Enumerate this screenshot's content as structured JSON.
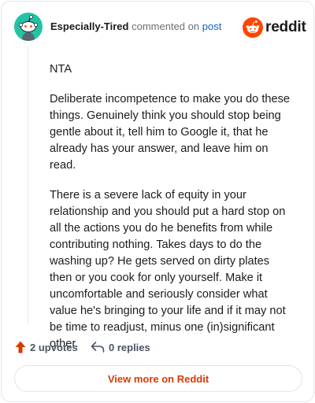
{
  "header": {
    "username": "Especially-Tired",
    "action_text": "commented on",
    "post_link": "post",
    "brand": "reddit"
  },
  "comment": {
    "paragraphs": [
      "NTA",
      "Deliberate incompetence to make you do these things. Genuinely think you should stop being gentle about it, tell him to Google it, that he already has your answer, and leave him on read.",
      "There is a severe lack of equity in your relationship and you should put a hard stop on all the actions you do he benefits from while contributing nothing. Takes days to do the washing up? He gets served on dirty plates then or you cook for only yourself. Make it uncomfortable and seriously consider what value he's bringing to your life and if it may not be time to readjust, minus one (in)significant other."
    ]
  },
  "actions": {
    "upvotes": "2 upvotes",
    "replies": "0 replies"
  },
  "cta": {
    "label": "View more on Reddit"
  },
  "icons": {
    "avatar": "snoo-avatar-icon",
    "brand": "reddit-logo-icon",
    "upvote": "upvote-arrow-icon",
    "reply": "reply-arrow-icon"
  },
  "colors": {
    "brand_orange": "#ff4500",
    "upvote": "#d93a00",
    "link": "#0a66c2",
    "avatar_bg": "#24c3a4"
  }
}
